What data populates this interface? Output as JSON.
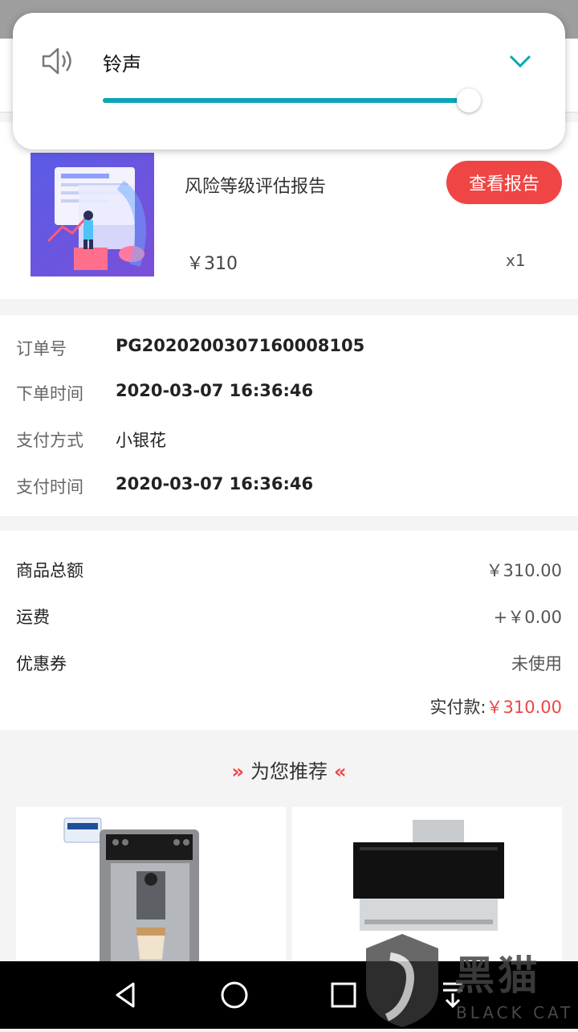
{
  "volume_panel": {
    "label": "铃声",
    "level": 1.0,
    "icons": [
      "speaker-icon",
      "chevron-down-icon"
    ],
    "accent_color": "#0aa6b8"
  },
  "product": {
    "title": "风险等级评估报告",
    "price": "￥310",
    "quantity": "x1",
    "report_button": "查看报告"
  },
  "order_info": {
    "rows": [
      {
        "label": "订单号",
        "value": "PG202020030716000810​5"
      },
      {
        "label": "下单时间",
        "value": "2020-03-07 16:36:46"
      },
      {
        "label": "支付方式",
        "value": "小银花"
      },
      {
        "label": "支付时间",
        "value": "2020-03-07 16:36:46"
      }
    ]
  },
  "amounts": {
    "rows": [
      {
        "label": "商品总额",
        "value": "￥310.00"
      },
      {
        "label": "运费",
        "value": "+￥0.00"
      },
      {
        "label": "优惠券",
        "value": "未使用"
      }
    ],
    "paid_label": "实付款:",
    "paid_value": "￥310.00"
  },
  "recommend": {
    "title": "为您推荐",
    "chevron_left": "»",
    "chevron_right": "«"
  },
  "watermark": {
    "text": "黑猫",
    "sub": "BLACK CAT"
  },
  "colors": {
    "accent_red": "#f04545",
    "slider": "#0aa6b8"
  }
}
